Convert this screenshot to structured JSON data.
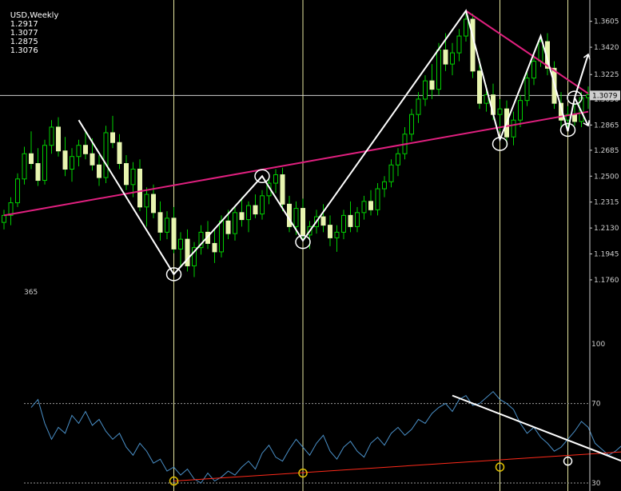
{
  "header": {
    "symbol_tf": "USD,Weekly",
    "open": "1.2917",
    "high": "1.3077",
    "low": "1.2875",
    "close": "1.3076"
  },
  "chart_data": {
    "type": "candlestick",
    "symbol": "USD",
    "timeframe": "Weekly",
    "price_axis": {
      "range": [
        1.16,
        1.37
      ],
      "ticks": [
        "1.3605",
        "1.3420",
        "1.3225",
        "1.3050",
        "1.2865",
        "1.2685",
        "1.2500",
        "1.2315",
        "1.2130",
        "1.1945",
        "1.1760"
      ],
      "current_price_label": "1.3079"
    },
    "candles": [
      [
        1.217,
        1.226,
        1.212,
        1.222
      ],
      [
        1.222,
        1.235,
        1.215,
        1.231
      ],
      [
        1.231,
        1.252,
        1.228,
        1.248
      ],
      [
        1.248,
        1.271,
        1.244,
        1.266
      ],
      [
        1.266,
        1.282,
        1.255,
        1.259
      ],
      [
        1.259,
        1.27,
        1.243,
        1.247
      ],
      [
        1.247,
        1.276,
        1.244,
        1.272
      ],
      [
        1.272,
        1.29,
        1.266,
        1.285
      ],
      [
        1.285,
        1.292,
        1.264,
        1.268
      ],
      [
        1.268,
        1.278,
        1.25,
        1.255
      ],
      [
        1.255,
        1.27,
        1.246,
        1.264
      ],
      [
        1.264,
        1.276,
        1.257,
        1.272
      ],
      [
        1.272,
        1.283,
        1.262,
        1.266
      ],
      [
        1.266,
        1.277,
        1.254,
        1.258
      ],
      [
        1.258,
        1.265,
        1.243,
        1.249
      ],
      [
        1.249,
        1.286,
        1.245,
        1.281
      ],
      [
        1.281,
        1.293,
        1.27,
        1.274
      ],
      [
        1.274,
        1.28,
        1.255,
        1.259
      ],
      [
        1.259,
        1.265,
        1.24,
        1.244
      ],
      [
        1.244,
        1.26,
        1.235,
        1.255
      ],
      [
        1.255,
        1.262,
        1.225,
        1.228
      ],
      [
        1.228,
        1.242,
        1.214,
        1.237
      ],
      [
        1.237,
        1.244,
        1.22,
        1.224
      ],
      [
        1.224,
        1.232,
        1.204,
        1.21
      ],
      [
        1.21,
        1.225,
        1.205,
        1.22
      ],
      [
        1.22,
        1.228,
        1.195,
        1.198
      ],
      [
        1.198,
        1.21,
        1.185,
        1.205
      ],
      [
        1.205,
        1.212,
        1.182,
        1.186
      ],
      [
        1.186,
        1.203,
        1.178,
        1.199
      ],
      [
        1.199,
        1.215,
        1.194,
        1.21
      ],
      [
        1.21,
        1.218,
        1.198,
        1.202
      ],
      [
        1.202,
        1.212,
        1.188,
        1.196
      ],
      [
        1.196,
        1.222,
        1.192,
        1.218
      ],
      [
        1.218,
        1.226,
        1.205,
        1.209
      ],
      [
        1.209,
        1.228,
        1.204,
        1.224
      ],
      [
        1.224,
        1.235,
        1.214,
        1.219
      ],
      [
        1.219,
        1.232,
        1.21,
        1.229
      ],
      [
        1.229,
        1.237,
        1.22,
        1.223
      ],
      [
        1.223,
        1.24,
        1.219,
        1.236
      ],
      [
        1.236,
        1.249,
        1.23,
        1.245
      ],
      [
        1.245,
        1.255,
        1.238,
        1.251
      ],
      [
        1.251,
        1.256,
        1.225,
        1.23
      ],
      [
        1.23,
        1.236,
        1.21,
        1.214
      ],
      [
        1.214,
        1.232,
        1.208,
        1.227
      ],
      [
        1.227,
        1.234,
        1.205,
        1.208
      ],
      [
        1.208,
        1.218,
        1.198,
        1.214
      ],
      [
        1.214,
        1.226,
        1.209,
        1.221
      ],
      [
        1.221,
        1.23,
        1.21,
        1.215
      ],
      [
        1.215,
        1.222,
        1.2,
        1.206
      ],
      [
        1.206,
        1.215,
        1.196,
        1.21
      ],
      [
        1.21,
        1.226,
        1.205,
        1.222
      ],
      [
        1.222,
        1.232,
        1.21,
        1.214
      ],
      [
        1.214,
        1.228,
        1.21,
        1.224
      ],
      [
        1.224,
        1.236,
        1.219,
        1.232
      ],
      [
        1.232,
        1.24,
        1.222,
        1.226
      ],
      [
        1.226,
        1.245,
        1.222,
        1.241
      ],
      [
        1.241,
        1.25,
        1.235,
        1.246
      ],
      [
        1.246,
        1.262,
        1.242,
        1.258
      ],
      [
        1.258,
        1.27,
        1.25,
        1.266
      ],
      [
        1.266,
        1.285,
        1.262,
        1.28
      ],
      [
        1.28,
        1.298,
        1.275,
        1.294
      ],
      [
        1.294,
        1.31,
        1.288,
        1.305
      ],
      [
        1.305,
        1.322,
        1.3,
        1.318
      ],
      [
        1.318,
        1.33,
        1.305,
        1.312
      ],
      [
        1.312,
        1.345,
        1.308,
        1.34
      ],
      [
        1.34,
        1.352,
        1.325,
        1.33
      ],
      [
        1.33,
        1.345,
        1.322,
        1.338
      ],
      [
        1.338,
        1.355,
        1.332,
        1.35
      ],
      [
        1.35,
        1.368,
        1.346,
        1.362
      ],
      [
        1.362,
        1.366,
        1.32,
        1.325
      ],
      [
        1.325,
        1.334,
        1.298,
        1.302
      ],
      [
        1.302,
        1.315,
        1.296,
        1.308
      ],
      [
        1.308,
        1.316,
        1.29,
        1.294
      ],
      [
        1.294,
        1.305,
        1.282,
        1.298
      ],
      [
        1.298,
        1.304,
        1.272,
        1.278
      ],
      [
        1.278,
        1.296,
        1.272,
        1.29
      ],
      [
        1.29,
        1.308,
        1.285,
        1.304
      ],
      [
        1.304,
        1.325,
        1.3,
        1.32
      ],
      [
        1.32,
        1.338,
        1.315,
        1.332
      ],
      [
        1.332,
        1.35,
        1.328,
        1.346
      ],
      [
        1.346,
        1.352,
        1.322,
        1.327
      ],
      [
        1.327,
        1.332,
        1.298,
        1.302
      ],
      [
        1.302,
        1.31,
        1.285,
        1.29
      ],
      [
        1.29,
        1.3,
        1.282,
        1.294
      ],
      [
        1.294,
        1.302,
        1.286,
        1.289
      ],
      [
        1.289,
        1.31,
        1.285,
        1.306
      ],
      [
        1.306,
        1.314,
        1.298,
        1.308
      ]
    ],
    "drawn_lines": [
      {
        "name": "lower-trendline",
        "color": "#e0207f",
        "from": [
          0,
          1.222
        ],
        "to": [
          86,
          1.296
        ]
      },
      {
        "name": "upper-trendline",
        "color": "#e0207f",
        "from": [
          68,
          1.368
        ],
        "to": [
          86,
          1.309
        ]
      },
      {
        "name": "pattern-zigzag",
        "color": "#ffffff",
        "points": [
          [
            11,
            1.29
          ],
          [
            25,
            1.18
          ],
          [
            38,
            1.25
          ],
          [
            44,
            1.204
          ],
          [
            68,
            1.368
          ],
          [
            73,
            1.276
          ],
          [
            79,
            1.35
          ],
          [
            83,
            1.282
          ],
          [
            84,
            1.306
          ]
        ]
      },
      {
        "name": "projection-up-arrow",
        "color": "#ffffff",
        "from": [
          84,
          1.306
        ],
        "to": [
          86,
          1.337
        ]
      },
      {
        "name": "projection-down-arrow",
        "color": "#ffffff",
        "from": [
          84,
          1.306
        ],
        "to": [
          86,
          1.286
        ]
      }
    ],
    "circles": [
      [
        25,
        1.18
      ],
      [
        38,
        1.25
      ],
      [
        44,
        1.203
      ],
      [
        73,
        1.273
      ],
      [
        83,
        1.283
      ],
      [
        84,
        1.306
      ]
    ],
    "vertical_markers": [
      25,
      44,
      73,
      83
    ],
    "crosshair_price": 1.3076,
    "indicator": {
      "label": "365",
      "range": [
        30,
        100
      ],
      "levels": [
        70,
        30
      ],
      "tick_labels": [
        "100",
        "70",
        "30"
      ],
      "color": "#4a90c8",
      "values": [
        68,
        72,
        60,
        52,
        58,
        55,
        64,
        60,
        66,
        59,
        62,
        56,
        52,
        55,
        48,
        44,
        50,
        46,
        40,
        42,
        36,
        38,
        34,
        37,
        32,
        30,
        35,
        31,
        33,
        36,
        34,
        38,
        41,
        37,
        45,
        49,
        43,
        41,
        47,
        52,
        48,
        44,
        50,
        54,
        46,
        42,
        48,
        51,
        46,
        43,
        50,
        53,
        49,
        55,
        58,
        54,
        57,
        62,
        60,
        65,
        68,
        70,
        66,
        72,
        74,
        69,
        70,
        73,
        76,
        72,
        70,
        67,
        60,
        55,
        58,
        53,
        50,
        46,
        48,
        52,
        56,
        61,
        58,
        50,
        47,
        44,
        46,
        49
      ],
      "lines": [
        {
          "name": "indicator-support-line",
          "color": "#ff2a1a",
          "from": [
            25,
            31
          ],
          "to": [
            97,
            47
          ]
        },
        {
          "name": "indicator-resistance-line",
          "color": "#ffffff",
          "from": [
            66,
            74
          ],
          "to": [
            94,
            37
          ]
        }
      ],
      "circles": [
        [
          25,
          31
        ],
        [
          44,
          35
        ],
        [
          73,
          38
        ],
        [
          83,
          41
        ]
      ]
    }
  }
}
